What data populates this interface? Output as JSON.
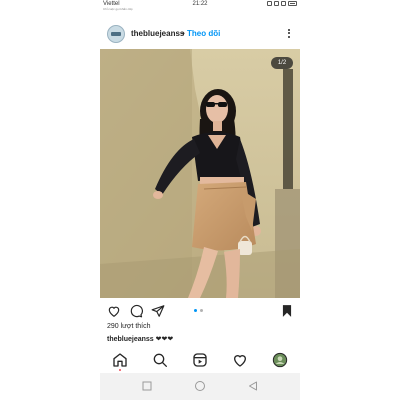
{
  "status_bar": {
    "carrier": "Viettel",
    "carrier_sub": "Chỉ cuộc gọi khẩn cấp",
    "time": "21:22"
  },
  "post": {
    "username": "thebluejeanss",
    "separator": "•",
    "follow_label": "Theo dõi",
    "image_counter": "1/2",
    "likes_text": "290 lượt thích",
    "caption_user": "thebluejeanss",
    "caption_text": "❤❤❤",
    "carousel": {
      "total": 2,
      "active": 1
    }
  },
  "colors": {
    "follow_blue": "#0095f6",
    "active_dot": "#0095f6",
    "inactive_dot": "#b3b3b3",
    "notification_dot": "#ed4956",
    "text": "#262626"
  },
  "icons": {
    "action_bar": [
      "heart-icon",
      "comment-icon",
      "share-icon",
      "bookmark-icon"
    ],
    "tab_bar": [
      "home-icon",
      "search-icon",
      "reels-icon",
      "activity-icon",
      "profile-icon"
    ],
    "android_nav": [
      "recents-square-icon",
      "home-circle-icon",
      "back-triangle-icon"
    ]
  }
}
